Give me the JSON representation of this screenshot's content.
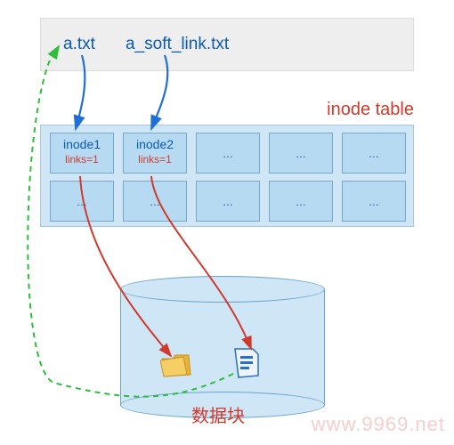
{
  "files": {
    "a": "a.txt",
    "b": "a_soft_link.txt"
  },
  "inode_table": {
    "title": "inode table",
    "row1": [
      {
        "name": "inode1",
        "links": "links=1"
      },
      {
        "name": "inode2",
        "links": "links=1"
      },
      {
        "name": "",
        "links": "",
        "dots": "..."
      },
      {
        "name": "",
        "links": "",
        "dots": "..."
      },
      {
        "name": "",
        "links": "",
        "dots": "..."
      }
    ],
    "row2": [
      {
        "dots": "..."
      },
      {
        "dots": "..."
      },
      {
        "dots": "..."
      },
      {
        "dots": "..."
      },
      {
        "dots": "..."
      }
    ]
  },
  "datablock_label": "数据块",
  "watermark": "www.9969.net",
  "icons": {
    "folder": "folder-icon",
    "file": "file-doc-icon"
  },
  "colors": {
    "blue": "#1e6fd8",
    "red": "#d03a2c",
    "green": "#2bbf3a",
    "cellbg": "#b7daf3",
    "tablebg": "#cfe6f7"
  }
}
